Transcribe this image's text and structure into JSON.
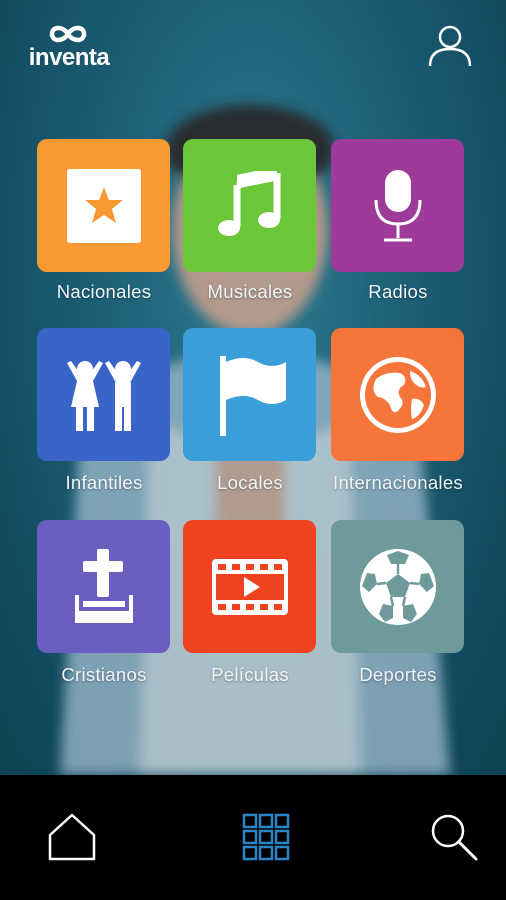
{
  "app": {
    "logo_text": "inventa"
  },
  "categories": [
    {
      "label": "Nacionales",
      "icon": "star-icon",
      "color": "#f89a33"
    },
    {
      "label": "Musicales",
      "icon": "music-note-icon",
      "color": "#6cc63a"
    },
    {
      "label": "Radios",
      "icon": "microphone-icon",
      "color": "#9e3a9a"
    },
    {
      "label": "Infantiles",
      "icon": "children-icon",
      "color": "#3a64c8"
    },
    {
      "label": "Locales",
      "icon": "flag-icon",
      "color": "#3a9ed8"
    },
    {
      "label": "Internacionales",
      "icon": "globe-icon",
      "color": "#f5753a"
    },
    {
      "label": "Cristianos",
      "icon": "cross-bible-icon",
      "color": "#6a5fc0"
    },
    {
      "label": "Películas",
      "icon": "film-play-icon",
      "color": "#f0421f"
    },
    {
      "label": "Deportes",
      "icon": "soccer-ball-icon",
      "color": "#6e9a9b"
    }
  ],
  "nav": {
    "items": [
      {
        "icon": "home-icon",
        "active": false
      },
      {
        "icon": "grid-icon",
        "active": true
      },
      {
        "icon": "search-icon",
        "active": false
      }
    ],
    "active_color": "#2a86c8"
  }
}
